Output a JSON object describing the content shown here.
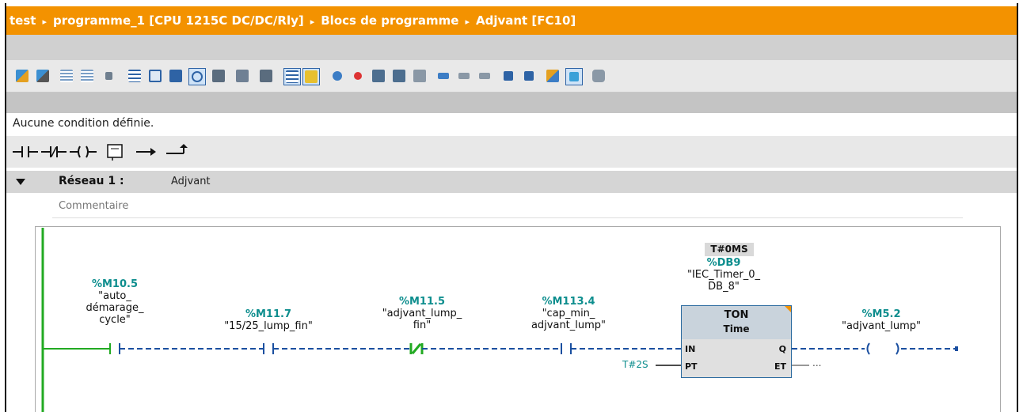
{
  "breadcrumb": {
    "items": [
      "test",
      "programme_1 [CPU 1215C DC/DC/Rly]",
      "Blocs de programme",
      "Adjvant [FC10]"
    ],
    "separator": "▸"
  },
  "toolbar": {
    "icons": [
      "insert-network-icon",
      "delete-network-icon",
      "insert-row-icon",
      "add-row-icon",
      "reset-icon",
      "absolute-operands-icon",
      "network-collapse-icon",
      "network-expand-icon",
      "show-comments-icon",
      "favorites-icon",
      "show-symbols-icon",
      "operand-representation-icon",
      "show-overview-icon",
      "go-to-error-icon",
      "go-to-previous-icon",
      "go-to-next-icon",
      "jump-icon",
      "compare-icon",
      "monitor-icon",
      "download-icon",
      "upload-icon",
      "fbd-icon",
      "ladder-icon",
      "properties-icon",
      "monitoring-on-icon",
      "call-structure-icon"
    ]
  },
  "status": {
    "condition_text": "Aucune condition définie."
  },
  "instructions": {
    "items": [
      "normally-open-contact-icon",
      "normally-closed-contact-icon",
      "coil-icon",
      "empty-box-icon",
      "open-branch-icon",
      "close-branch-icon"
    ]
  },
  "network": {
    "title": "Réseau 1 :",
    "name": "Adjvant",
    "comment_placeholder": "Commentaire"
  },
  "ladder": {
    "contacts": [
      {
        "address": "%M10.5",
        "symbol_lines": [
          "\"auto_",
          "démarage_",
          "cycle\""
        ],
        "type": "NO"
      },
      {
        "address": "%M11.7",
        "symbol_lines": [
          "\"15/25_lump_fin\""
        ],
        "type": "NO"
      },
      {
        "address": "%M11.5",
        "symbol_lines": [
          "\"adjvant_lump_",
          "fin\""
        ],
        "type": "NC"
      },
      {
        "address": "%M113.4",
        "symbol_lines": [
          "\"cap_min_",
          "adjvant_lump\""
        ],
        "type": "NO"
      }
    ],
    "timer": {
      "monitor_value": "T#0MS",
      "db_address": "%DB9",
      "db_lines": [
        "\"IEC_Timer_0_",
        "DB_8\""
      ],
      "type": "TON",
      "subtype": "Time",
      "pin_in": "IN",
      "pin_pt": "PT",
      "pin_q": "Q",
      "pin_et": "ET",
      "pt_value": "T#2S",
      "et_value": "..."
    },
    "coil": {
      "address": "%M5.2",
      "symbol": "\"adjvant_lump\""
    }
  },
  "colors": {
    "breadcrumb_bg": "#f39200",
    "address": "#0e8e8e",
    "rail": "#22aa22",
    "wire": "#1a4fa0"
  }
}
